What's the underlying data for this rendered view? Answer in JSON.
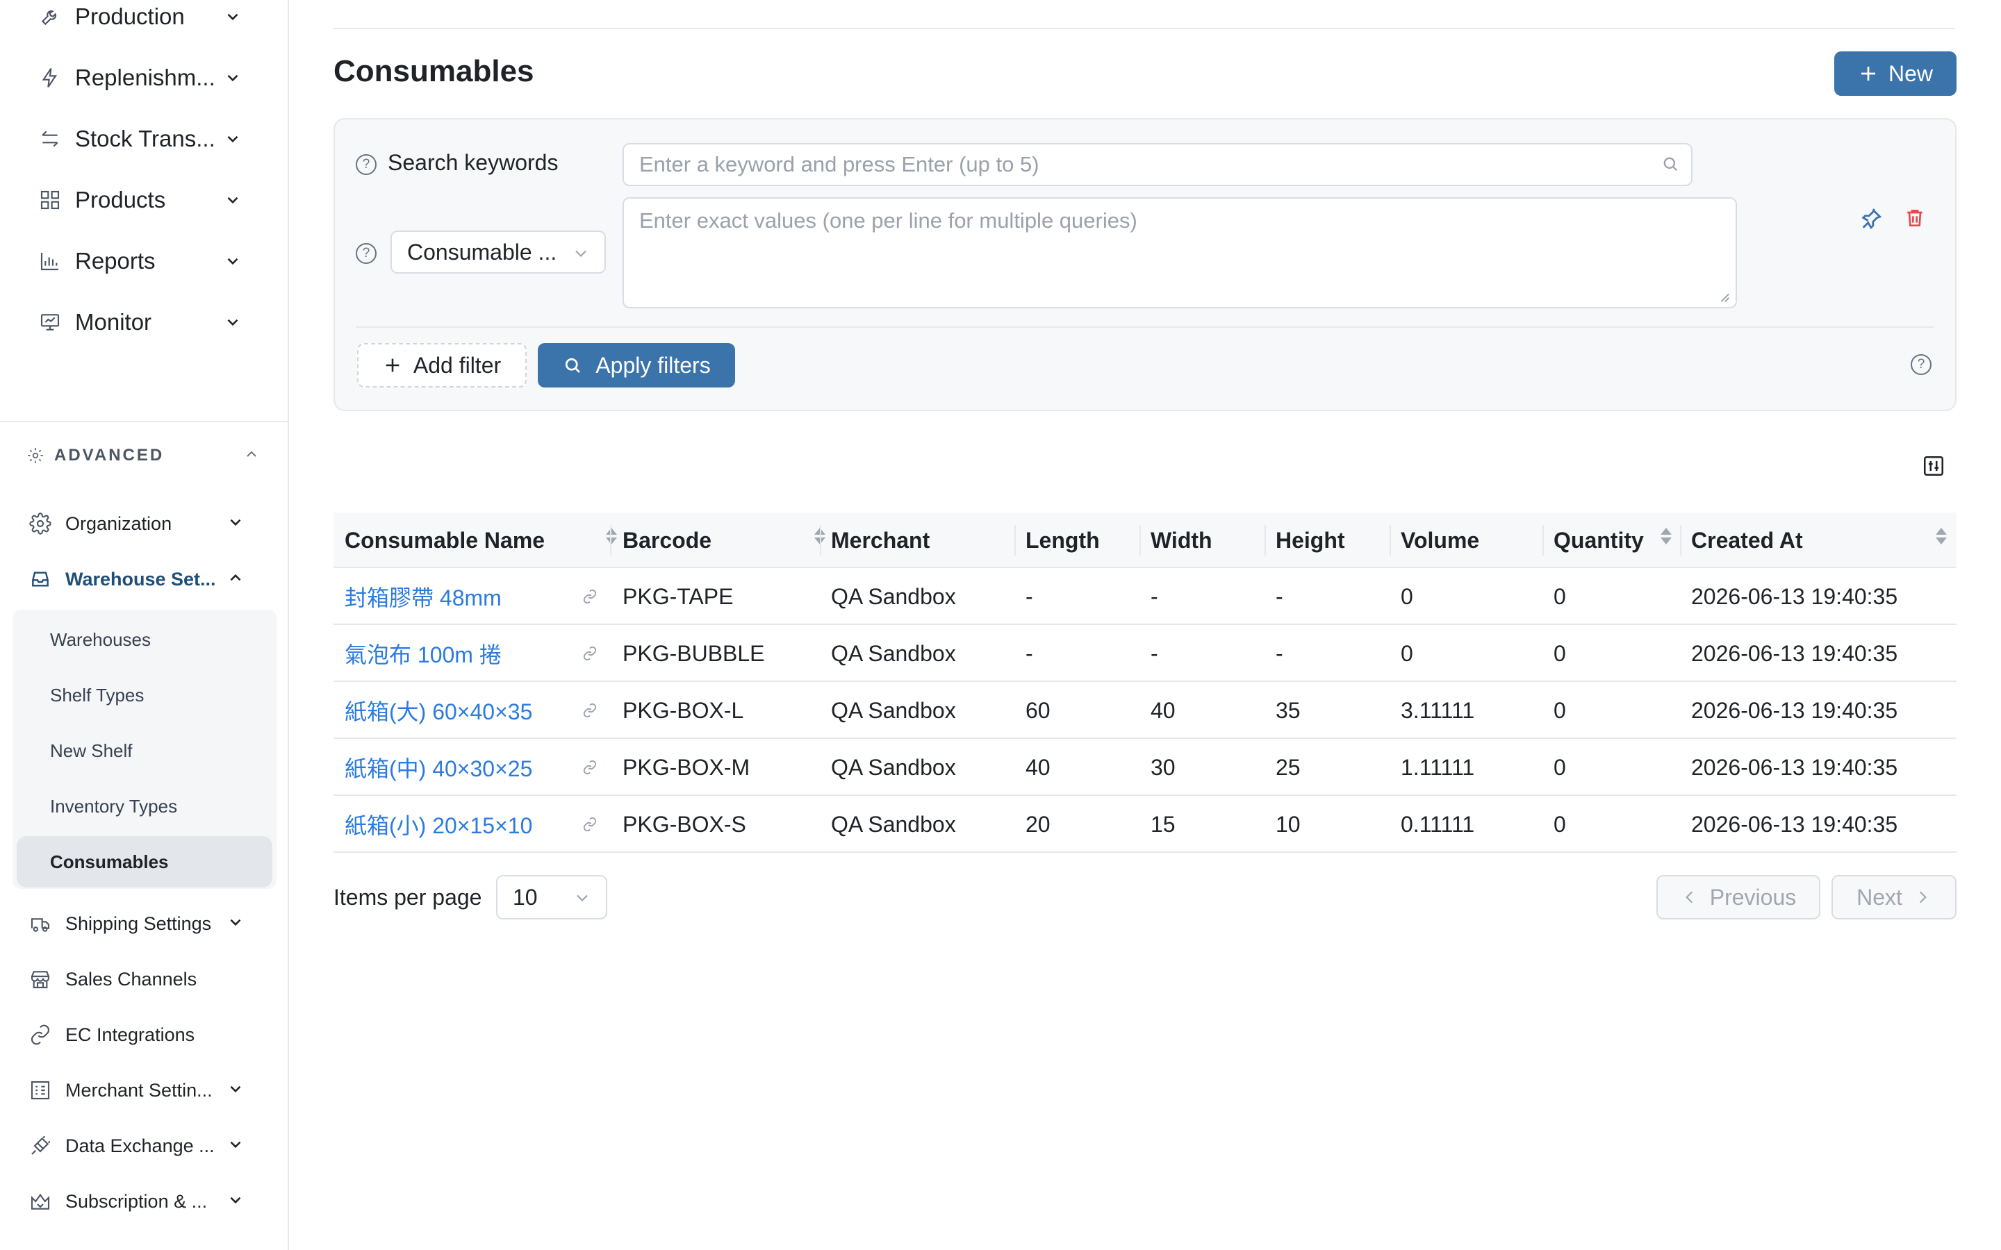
{
  "sidebar": {
    "top_items": [
      {
        "label": "Production",
        "icon": "wrench-icon"
      },
      {
        "label": "Replenishm...",
        "icon": "lightning-icon"
      },
      {
        "label": "Stock Trans...",
        "icon": "transfer-arrows-icon"
      },
      {
        "label": "Products",
        "icon": "grid-icon"
      },
      {
        "label": "Reports",
        "icon": "bar-chart-icon"
      },
      {
        "label": "Monitor",
        "icon": "monitor-icon"
      }
    ],
    "section_label": "ADVANCED",
    "advanced_items": [
      {
        "label": "Organization",
        "icon": "gear-icon"
      },
      {
        "label": "Warehouse Set...",
        "icon": "inbox-icon"
      },
      {
        "label": "Shipping Settings",
        "icon": "truck-icon"
      },
      {
        "label": "Sales Channels",
        "icon": "store-icon"
      },
      {
        "label": "EC Integrations",
        "icon": "link-icon"
      },
      {
        "label": "Merchant Settin...",
        "icon": "merchant-grid-icon"
      },
      {
        "label": "Data Exchange ...",
        "icon": "api-plug-icon"
      },
      {
        "label": "Subscription & ...",
        "icon": "crown-icon"
      }
    ],
    "warehouse_children": [
      "Warehouses",
      "Shelf Types",
      "New Shelf",
      "Inventory Types",
      "Consumables"
    ]
  },
  "page": {
    "title": "Consumables",
    "new_button": "New"
  },
  "filters": {
    "search_label": "Search keywords",
    "search_placeholder": "Enter a keyword and press Enter (up to 5)",
    "field_select": "Consumable ...",
    "values_placeholder": "Enter exact values (one per line for multiple queries)",
    "add_filter": "Add filter",
    "apply_filters": "Apply filters"
  },
  "table": {
    "columns": [
      "Consumable Name",
      "Barcode",
      "Merchant",
      "Length",
      "Width",
      "Height",
      "Volume",
      "Quantity",
      "Created At"
    ],
    "rows": [
      [
        "封箱膠帶 48mm",
        "PKG-TAPE",
        "QA Sandbox",
        "-",
        "-",
        "-",
        "0",
        "0",
        "2026-06-13 19:40:35"
      ],
      [
        "氣泡布 100m 捲",
        "PKG-BUBBLE",
        "QA Sandbox",
        "-",
        "-",
        "-",
        "0",
        "0",
        "2026-06-13 19:40:35"
      ],
      [
        "紙箱(大) 60×40×35",
        "PKG-BOX-L",
        "QA Sandbox",
        "60",
        "40",
        "35",
        "3.11111",
        "0",
        "2026-06-13 19:40:35"
      ],
      [
        "紙箱(中) 40×30×25",
        "PKG-BOX-M",
        "QA Sandbox",
        "40",
        "30",
        "25",
        "1.11111",
        "0",
        "2026-06-13 19:40:35"
      ],
      [
        "紙箱(小) 20×15×10",
        "PKG-BOX-S",
        "QA Sandbox",
        "20",
        "15",
        "10",
        "0.11111",
        "0",
        "2026-06-13 19:40:35"
      ]
    ]
  },
  "pagination": {
    "items_per_page_label": "Items per page",
    "items_per_page_value": "10",
    "previous": "Previous",
    "next": "Next"
  },
  "colors": {
    "primary": "#3b73ab",
    "link": "#2b7be0",
    "danger": "#e5484d",
    "active_nav": "#1f4e79"
  }
}
